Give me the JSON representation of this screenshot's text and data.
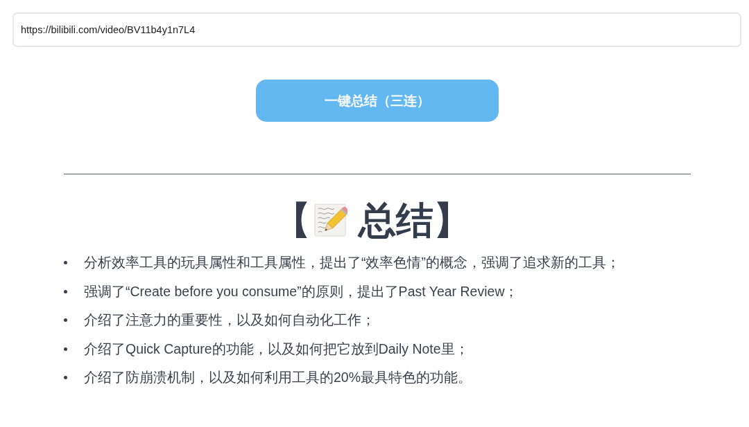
{
  "url_field": {
    "value": "https://bilibili.com/video/BV11b4y1n7L4"
  },
  "summarize_button": {
    "label": "一键总结（三连）"
  },
  "summary": {
    "heading": {
      "open": "【",
      "text": "总结】"
    },
    "points": [
      "分析效率工具的玩具属性和工具属性，提出了“效率色情”的概念，强调了追求新的工具；",
      "强调了“Create before you consume”的原则，提出了Past Year Review；",
      "介绍了注意力的重要性，以及如何自动化工作；",
      "介绍了Quick Capture的功能，以及如何把它放到Daily Note里；",
      "介绍了防崩溃机制，以及如何利用工具的20%最具特色的功能。"
    ]
  }
}
